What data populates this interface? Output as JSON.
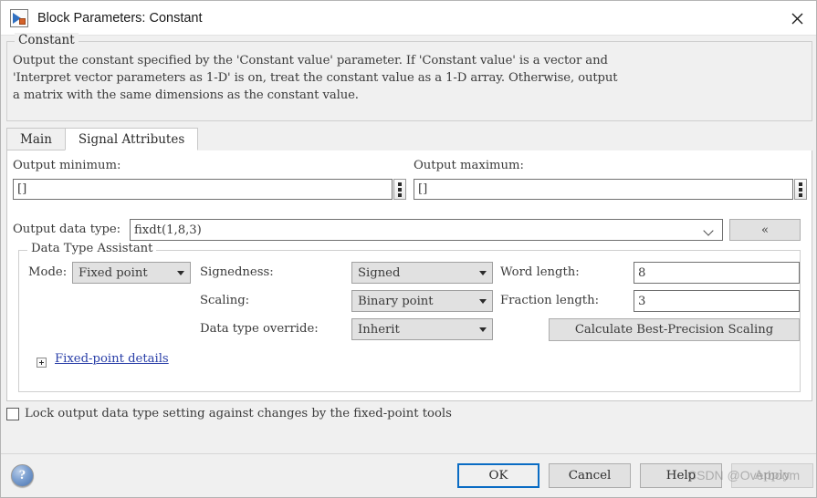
{
  "window": {
    "title": "Block Parameters: Constant",
    "icon": "simulink-block-icon",
    "close_label": "✕"
  },
  "description": {
    "legend": "Constant",
    "text": "Output the constant specified by the 'Constant value' parameter. If 'Constant value' is a vector and\n'Interpret vector parameters as 1-D' is on, treat the constant value as a 1-D array. Otherwise, output\na matrix with the same dimensions as the constant value."
  },
  "tabs": [
    {
      "label": "Main",
      "active": false
    },
    {
      "label": "Signal Attributes",
      "active": true
    }
  ],
  "fields": {
    "output_minimum_label": "Output minimum:",
    "output_minimum_value": "[]",
    "output_maximum_label": "Output maximum:",
    "output_maximum_value": "[]",
    "output_data_type_label": "Output data type:",
    "output_data_type_value": "fixdt(1,8,3)",
    "collapse_button_label": "«"
  },
  "data_type_assistant": {
    "legend": "Data Type Assistant",
    "mode_label": "Mode:",
    "mode_value": "Fixed point",
    "signedness_label": "Signedness:",
    "signedness_value": "Signed",
    "scaling_label": "Scaling:",
    "scaling_value": "Binary point",
    "data_type_override_label": "Data type override:",
    "data_type_override_value": "Inherit",
    "word_length_label": "Word length:",
    "word_length_value": "8",
    "fraction_length_label": "Fraction length:",
    "fraction_length_value": "3",
    "calculate_button_label": "Calculate Best-Precision Scaling",
    "fixed_point_details_link": "Fixed-point details",
    "expander_state": "collapsed"
  },
  "lock_checkbox": {
    "label": "Lock output data type setting against changes by the fixed-point tools",
    "checked": false
  },
  "footer": {
    "help_orb_label": "?",
    "ok_label": "OK",
    "cancel_label": "Cancel",
    "help_label": "Help",
    "apply_label": "Apply",
    "apply_enabled": false
  },
  "watermark": "CSDN @Overboom",
  "colors": {
    "default_button_border": "#0a6cc4",
    "link": "#2a3fa8",
    "dialog_background": "#f0f0f0",
    "panel_background": "#ffffff"
  }
}
